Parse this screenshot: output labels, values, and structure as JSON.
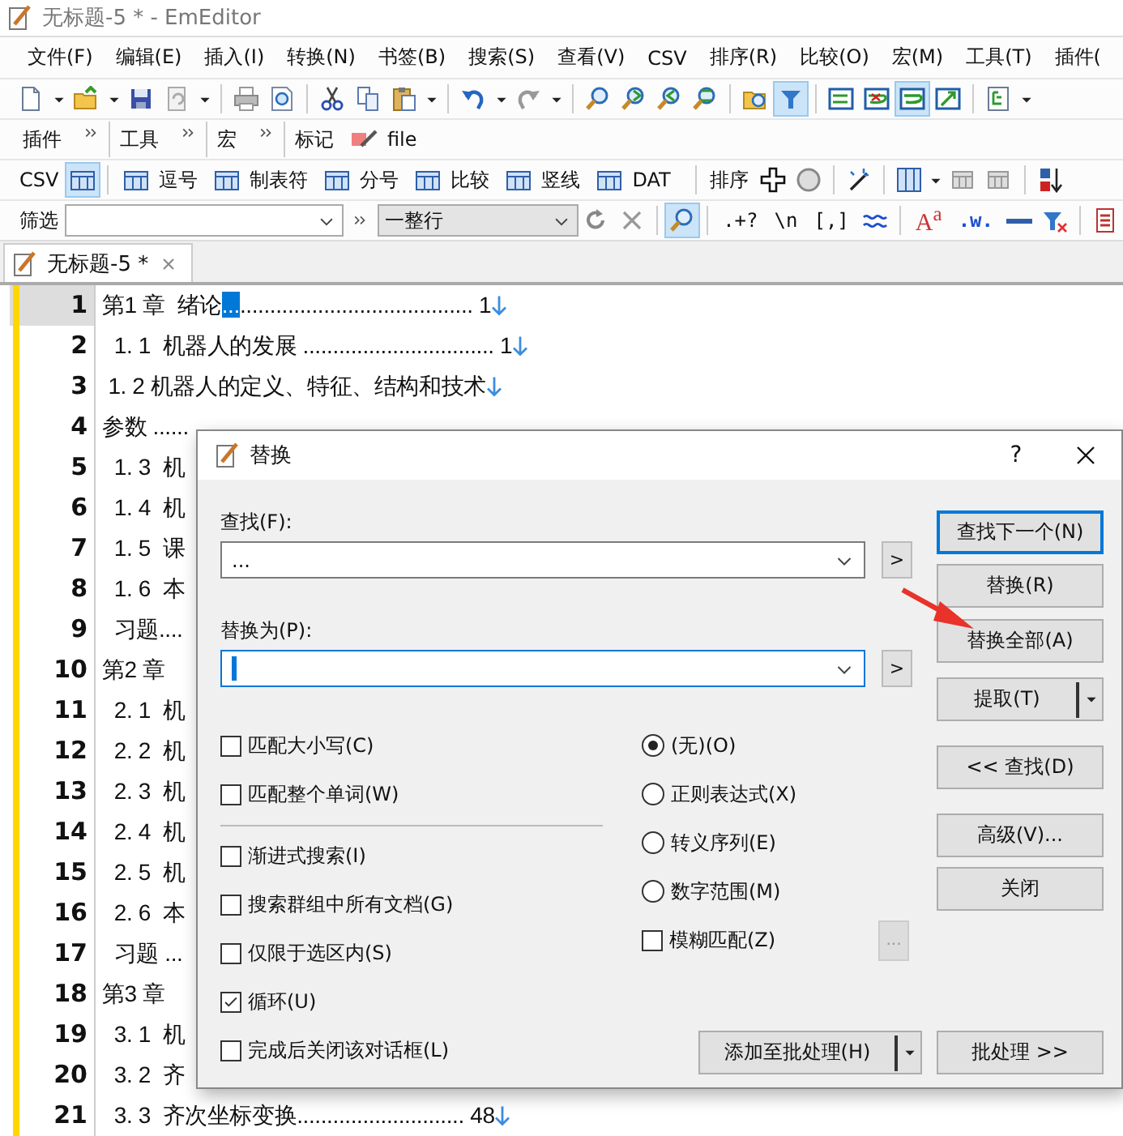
{
  "window": {
    "title": "无标题-5 * - EmEditor"
  },
  "menu": [
    {
      "label": "文件(F)"
    },
    {
      "label": "编辑(E)"
    },
    {
      "label": "插入(I)"
    },
    {
      "label": "转换(N)"
    },
    {
      "label": "书签(B)"
    },
    {
      "label": "搜索(S)"
    },
    {
      "label": "查看(V)"
    },
    {
      "label": "CSV"
    },
    {
      "label": "排序(R)"
    },
    {
      "label": "比较(O)"
    },
    {
      "label": "宏(M)"
    },
    {
      "label": "工具(T)"
    },
    {
      "label": "插件("
    }
  ],
  "toolbar": [
    {
      "selected": false
    },
    {
      "selected": false
    },
    {
      "selected": false
    },
    {
      "selected": false
    },
    {
      "selected": false
    },
    {
      "selected": false
    },
    {
      "selected": false
    },
    {
      "selected": false
    },
    {
      "selected": false
    },
    {
      "selected": false
    },
    {
      "selected": false
    },
    {
      "selected": false
    },
    {
      "selected": false
    },
    {
      "selected": false
    },
    {
      "selected": false
    },
    {
      "selected": false
    },
    {
      "selected": true
    },
    {
      "selected": false
    },
    {
      "selected": false
    },
    {
      "selected": true
    },
    {
      "selected": false
    },
    {
      "selected": false
    }
  ],
  "toolbar_bars": [
    {
      "label": "插件"
    },
    {
      "label": "工具"
    },
    {
      "label": "宏"
    }
  ],
  "mark_bar": {
    "label": "标记",
    "item": "file"
  },
  "csv_bar": {
    "label": "CSV",
    "grid_selected": true,
    "formats": [
      "逗号",
      "制表符",
      "分号",
      "比较",
      "竖线",
      "DAT"
    ],
    "sort_label": "排序"
  },
  "filter_bar": {
    "label": "筛选",
    "mode": "一整行",
    "search_selected": true,
    "tools": [
      ".+?",
      "\\n",
      "[,]"
    ],
    "case_tool": "A$^{a}$",
    "word_tool": ".w."
  },
  "tabs": [
    {
      "label": "无标题-5 *",
      "selected": true
    }
  ],
  "editor": {
    "lines": [
      {
        "number": "1",
        "text": "第1 章  绪论",
        "selection": "...",
        "rest": "....................................... 1",
        "eol": true,
        "current": true
      },
      {
        "number": "2",
        "text": "  1. 1  机器人的发展 ................................ 1",
        "eol": true,
        "current": false
      },
      {
        "number": "3",
        "text": " 1. 2 机器人的定义、特征、结构和技术",
        "eol": true,
        "current": false
      },
      {
        "number": "4",
        "text": "参数 ......",
        "eol": false,
        "current": false
      },
      {
        "number": "5",
        "text": "  1. 3  机",
        "eol": false,
        "current": false
      },
      {
        "number": "6",
        "text": "  1. 4  机",
        "eol": false,
        "current": false
      },
      {
        "number": "7",
        "text": "  1. 5  课",
        "eol": false,
        "current": false
      },
      {
        "number": "8",
        "text": "  1. 6  本",
        "eol": false,
        "current": false
      },
      {
        "number": "9",
        "text": "  习题....",
        "eol": false,
        "current": false
      },
      {
        "number": "10",
        "text": "第2 章",
        "eol": false,
        "current": false
      },
      {
        "number": "11",
        "text": "  2. 1  机",
        "eol": false,
        "current": false
      },
      {
        "number": "12",
        "text": "  2. 2  机",
        "eol": false,
        "current": false
      },
      {
        "number": "13",
        "text": "  2. 3  机",
        "eol": false,
        "current": false
      },
      {
        "number": "14",
        "text": "  2. 4  机",
        "eol": false,
        "current": false
      },
      {
        "number": "15",
        "text": "  2. 5  机",
        "eol": false,
        "current": false
      },
      {
        "number": "16",
        "text": "  2. 6  本",
        "eol": false,
        "current": false
      },
      {
        "number": "17",
        "text": "  习题 ...",
        "eol": false,
        "current": false
      },
      {
        "number": "18",
        "text": "第3 章",
        "eol": false,
        "current": false
      },
      {
        "number": "19",
        "text": "  3. 1  机",
        "eol": false,
        "current": false
      },
      {
        "number": "20",
        "text": "  3. 2  齐",
        "eol": false,
        "current": false
      },
      {
        "number": "21",
        "text": "  3. 3  齐次坐标变换............................ 48",
        "eol": true,
        "current": false
      }
    ]
  },
  "dialog": {
    "title": "替换",
    "help": "?",
    "find_label": "查找(F):",
    "find_value": "...",
    "replace_label": "替换为(P):",
    "history_buttons": [
      ">",
      ">"
    ],
    "buttons": [
      {
        "label": "查找下一个(N)",
        "default": true,
        "dropdown": false
      },
      {
        "label": "替换(R)",
        "default": false,
        "dropdown": false
      },
      {
        "label": "替换全部(A)",
        "default": false,
        "dropdown": false
      },
      {
        "label": "提取(T)",
        "default": false,
        "dropdown": true
      },
      {
        "label": "<< 查找(D)",
        "default": false,
        "dropdown": false
      },
      {
        "label": "高级(V)...",
        "default": false,
        "dropdown": false
      },
      {
        "label": "关闭",
        "default": false,
        "dropdown": false
      }
    ],
    "options_top": [
      {
        "label": "匹配大小写(C)",
        "checked": false
      },
      {
        "label": "匹配整个单词(W)",
        "checked": false
      }
    ],
    "options_bottom": [
      {
        "label": "渐进式搜索(I)",
        "checked": false
      },
      {
        "label": "搜索群组中所有文档(G)",
        "checked": false
      },
      {
        "label": "仅限于选区内(S)",
        "checked": false
      },
      {
        "label": "循环(U)",
        "checked": true
      },
      {
        "label": "完成后关闭该对话框(L)",
        "checked": false
      }
    ],
    "modes": [
      {
        "label": "(无)(O)",
        "selected": true
      },
      {
        "label": "正则表达式(X)",
        "selected": false
      },
      {
        "label": "转义序列(E)",
        "selected": false
      },
      {
        "label": "数字范围(M)",
        "selected": false
      }
    ],
    "fuzzy": {
      "label": "模糊匹配(Z)",
      "checked": false,
      "button": "...",
      "disabled": true
    },
    "batch_add": {
      "label": "添加至批处理(H)",
      "dropdown": true
    },
    "batch": {
      "label": "批处理 >>"
    }
  }
}
